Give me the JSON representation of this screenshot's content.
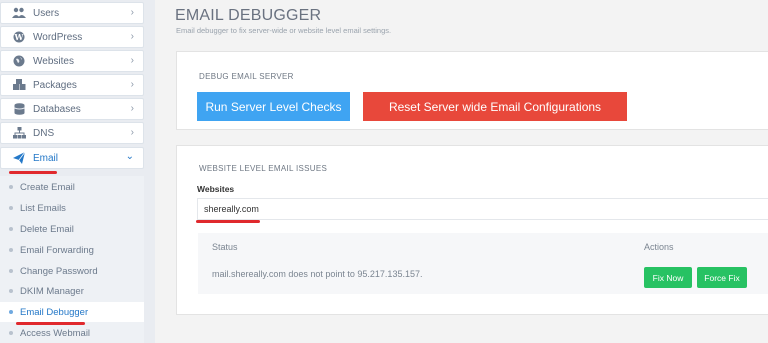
{
  "sidebar": {
    "items": [
      {
        "label": "Users",
        "icon": "users-icon"
      },
      {
        "label": "WordPress",
        "icon": "wordpress-icon"
      },
      {
        "label": "Websites",
        "icon": "globe-icon"
      },
      {
        "label": "Packages",
        "icon": "packages-icon"
      },
      {
        "label": "Databases",
        "icon": "database-icon"
      },
      {
        "label": "DNS",
        "icon": "sitemap-icon"
      },
      {
        "label": "Email",
        "icon": "paper-plane-icon"
      }
    ],
    "email_subitems": [
      "Create Email",
      "List Emails",
      "Delete Email",
      "Email Forwarding",
      "Change Password",
      "DKIM Manager",
      "Email Debugger",
      "Access Webmail"
    ]
  },
  "header": {
    "title": "EMAIL DEBUGGER",
    "subtitle": "Email debugger to fix server-wide or website level email settings."
  },
  "server_card": {
    "title": "DEBUG EMAIL SERVER",
    "run_checks_label": "Run Server Level Checks",
    "reset_label": "Reset Server wide Email Configurations"
  },
  "website_card": {
    "title": "WEBSITE LEVEL EMAIL ISSUES",
    "websites_label": "Websites",
    "selected_website": "shereally.com",
    "table": {
      "headers": {
        "status": "Status",
        "actions": "Actions"
      },
      "rows": [
        {
          "status": "mail.shereally.com does not point to 95.217.135.157.",
          "fix_now": "Fix Now",
          "force_fix": "Force Fix"
        }
      ]
    }
  },
  "colors": {
    "accent_blue": "#3fa4f2",
    "danger_red": "#e8483b",
    "success_green": "#27c263",
    "annotation_red": "#e0292d",
    "active_link": "#2478c8"
  }
}
